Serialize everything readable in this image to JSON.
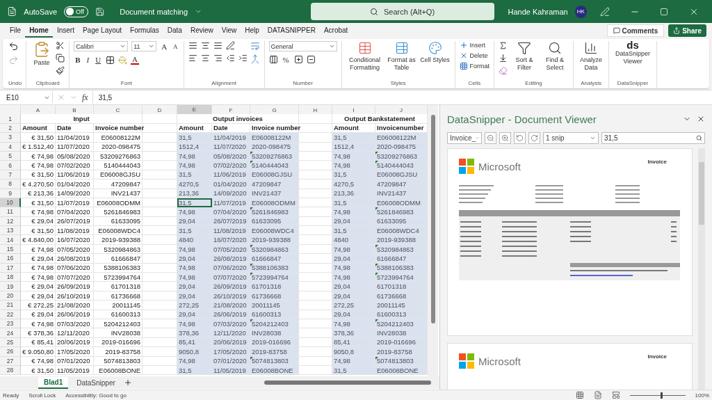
{
  "title_bar": {
    "autosave_label": "AutoSave",
    "autosave_toggle": {
      "label": "Off",
      "on": false
    },
    "document_title": "Document matching",
    "search": {
      "placeholder": "Search (Alt+Q)"
    },
    "user_name": "Hande Kahraman",
    "avatar_initials": "HK"
  },
  "menu_tabs": [
    {
      "label": "File",
      "selected": false
    },
    {
      "label": "Home",
      "selected": true
    },
    {
      "label": "Insert",
      "selected": false
    },
    {
      "label": "Page Layout",
      "selected": false
    },
    {
      "label": "Formulas",
      "selected": false
    },
    {
      "label": "Data",
      "selected": false
    },
    {
      "label": "Review",
      "selected": false
    },
    {
      "label": "View",
      "selected": false
    },
    {
      "label": "Help",
      "selected": false
    },
    {
      "label": "DATASNIPPER",
      "selected": false
    },
    {
      "label": "Acrobat",
      "selected": false
    }
  ],
  "comments_button": "Comments",
  "share_button": "Share",
  "ribbon": [
    {
      "kind": "undo",
      "label": "Undo"
    },
    {
      "kind": "clipboard",
      "label": "Clipboard",
      "paste": "Paste"
    },
    {
      "kind": "font",
      "label": "Font",
      "font_name": "Calibri",
      "font_size": "11",
      "grow_font": "A",
      "shrink_font": "A",
      "bold": "B",
      "italic": "I",
      "underline": "U",
      "font_color": "A"
    },
    {
      "kind": "alignment",
      "label": "Alignment"
    },
    {
      "kind": "number",
      "label": "Number",
      "format": "General",
      "percent": "%"
    },
    {
      "kind": "styles",
      "label": "Styles",
      "buttons": [
        "Conditional Formatting",
        "Format as Table",
        "Cell Styles"
      ]
    },
    {
      "kind": "cells",
      "label": "Cells",
      "buttons": [
        "Insert",
        "Delete",
        "Format"
      ]
    },
    {
      "kind": "editing",
      "label": "Editing",
      "buttons": [
        "Sort & Filter",
        "Find & Select"
      ]
    },
    {
      "kind": "analysis",
      "label": "Analysis",
      "buttons": [
        "Analyze Data"
      ]
    },
    {
      "kind": "datasnipper",
      "label": "DataSnipper",
      "logo": "ds",
      "buttons": [
        "DataSnipper Viewer"
      ]
    }
  ],
  "formula_bar": {
    "name_box": "E10",
    "fx": "fx",
    "value": "31,5"
  },
  "sheet": {
    "columns": [
      {
        "label": "A",
        "selected": false
      },
      {
        "label": "B",
        "selected": false
      },
      {
        "label": "C",
        "selected": false
      },
      {
        "label": "D",
        "selected": false
      },
      {
        "label": "E",
        "selected": true
      },
      {
        "label": "F",
        "selected": false
      },
      {
        "label": "G",
        "selected": false
      },
      {
        "label": "H",
        "selected": false
      },
      {
        "label": "I",
        "selected": false
      },
      {
        "label": "J",
        "selected": false
      }
    ],
    "title_row": {
      "row": "1",
      "input": "Input",
      "output_invoices": "Output invoices",
      "output_bank": "Output Bankstatement"
    },
    "heading_row": {
      "row": "2",
      "input": [
        "Amount",
        "Date",
        "Invoice number"
      ],
      "output_invoices": [
        "Amount",
        "Date",
        "Invoice number"
      ],
      "output_bank": [
        "Amount",
        "Invoicenumber"
      ]
    },
    "rows": [
      {
        "row": "3",
        "input": [
          "€ 31,50",
          "11/04/2019",
          "E06008122M"
        ],
        "output_invoices": [
          "31,5",
          "11/04/2019",
          "E06008122M"
        ],
        "output_bank": [
          "31,5",
          "E06008122M"
        ],
        "flagged": false,
        "selected": false
      },
      {
        "row": "4",
        "input": [
          "€ 1.512,40",
          "11/07/2020",
          "2020-098475"
        ],
        "output_invoices": [
          "1512,4",
          "11/07/2020",
          "2020-098475"
        ],
        "output_bank": [
          "1512,4",
          "2020-098475"
        ],
        "flagged": false,
        "selected": false
      },
      {
        "row": "5",
        "input": [
          "€ 74,98",
          "05/08/2020",
          "53209276863"
        ],
        "output_invoices": [
          "74,98",
          "05/08/2020",
          "53209276863"
        ],
        "output_bank": [
          "74,98",
          "53209276863"
        ],
        "flagged": true,
        "selected": false
      },
      {
        "row": "6",
        "input": [
          "€ 74,98",
          "07/02/2020",
          "5140444043"
        ],
        "output_invoices": [
          "74,98",
          "07/02/2020",
          "5140444043"
        ],
        "output_bank": [
          "74,98",
          "5140444043"
        ],
        "flagged": true,
        "selected": false
      },
      {
        "row": "7",
        "input": [
          "€ 31,50",
          "11/06/2019",
          "E06008GJSU"
        ],
        "output_invoices": [
          "31,5",
          "11/06/2019",
          "E06008GJSU"
        ],
        "output_bank": [
          "31,5",
          "E06008GJSU"
        ],
        "flagged": false,
        "selected": false
      },
      {
        "row": "8",
        "input": [
          "€ 4.270,50",
          "01/04/2020",
          "47209847"
        ],
        "output_invoices": [
          "4270,5",
          "01/04/2020",
          "47209847"
        ],
        "output_bank": [
          "4270,5",
          "47209847"
        ],
        "flagged": false,
        "selected": false
      },
      {
        "row": "9",
        "input": [
          "€ 213,36",
          "14/09/2020",
          "INV21437"
        ],
        "output_invoices": [
          "213,36",
          "14/09/2020",
          "INV21437"
        ],
        "output_bank": [
          "213,36",
          "INV21437"
        ],
        "flagged": false,
        "selected": false
      },
      {
        "row": "10",
        "input": [
          "€ 31,50",
          "11/07/2019",
          "E06008ODMM"
        ],
        "output_invoices": [
          "31,5",
          "11/07/2019",
          "E06008ODMM"
        ],
        "output_bank": [
          "31,5",
          "E06008ODMM"
        ],
        "flagged": false,
        "selected": true
      },
      {
        "row": "11",
        "input": [
          "€ 74,98",
          "07/04/2020",
          "5261846983"
        ],
        "output_invoices": [
          "74,98",
          "07/04/2020",
          "5261846983"
        ],
        "output_bank": [
          "74,98",
          "5261846983"
        ],
        "flagged": true,
        "selected": false
      },
      {
        "row": "12",
        "input": [
          "€ 29,04",
          "26/07/2019",
          "61633095"
        ],
        "output_invoices": [
          "29,04",
          "26/07/2019",
          "61633095"
        ],
        "output_bank": [
          "29,04",
          "61633095"
        ],
        "flagged": false,
        "selected": false
      },
      {
        "row": "13",
        "input": [
          "€ 31,50",
          "11/08/2019",
          "E06008WDC4"
        ],
        "output_invoices": [
          "31,5",
          "11/08/2019",
          "E06008WDC4"
        ],
        "output_bank": [
          "31,5",
          "E06008WDC4"
        ],
        "flagged": false,
        "selected": false
      },
      {
        "row": "14",
        "input": [
          "€ 4.840,00",
          "16/07/2020",
          "2019-939388"
        ],
        "output_invoices": [
          "4840",
          "16/07/2020",
          "2019-939388"
        ],
        "output_bank": [
          "4840",
          "2019-939388"
        ],
        "flagged": false,
        "selected": false
      },
      {
        "row": "15",
        "input": [
          "€ 74,98",
          "07/05/2020",
          "5320984863"
        ],
        "output_invoices": [
          "74,98",
          "07/05/2020",
          "5320984863"
        ],
        "output_bank": [
          "74,98",
          "5320984863"
        ],
        "flagged": true,
        "selected": false
      },
      {
        "row": "16",
        "input": [
          "€ 29,04",
          "26/08/2019",
          "61666847"
        ],
        "output_invoices": [
          "29,04",
          "26/08/2019",
          "61666847"
        ],
        "output_bank": [
          "29,04",
          "61666847"
        ],
        "flagged": false,
        "selected": false
      },
      {
        "row": "17",
        "input": [
          "€ 74,98",
          "07/06/2020",
          "5388106383"
        ],
        "output_invoices": [
          "74,98",
          "07/06/2020",
          "5388106383"
        ],
        "output_bank": [
          "74,98",
          "5388106383"
        ],
        "flagged": true,
        "selected": false
      },
      {
        "row": "18",
        "input": [
          "€ 74,98",
          "07/07/2020",
          "5723994764"
        ],
        "output_invoices": [
          "74,98",
          "07/07/2020",
          "5723994764"
        ],
        "output_bank": [
          "74,98",
          "5723994764"
        ],
        "flagged": true,
        "selected": false
      },
      {
        "row": "19",
        "input": [
          "€ 29,04",
          "26/09/2019",
          "61701318"
        ],
        "output_invoices": [
          "29,04",
          "26/09/2019",
          "61701318"
        ],
        "output_bank": [
          "29,04",
          "61701318"
        ],
        "flagged": false,
        "selected": false
      },
      {
        "row": "20",
        "input": [
          "€ 29,04",
          "26/10/2019",
          "61736668"
        ],
        "output_invoices": [
          "29,04",
          "26/10/2019",
          "61736668"
        ],
        "output_bank": [
          "29,04",
          "61736668"
        ],
        "flagged": false,
        "selected": false
      },
      {
        "row": "21",
        "input": [
          "€ 272,25",
          "21/08/2020",
          "20011145"
        ],
        "output_invoices": [
          "272,25",
          "21/08/2020",
          "20011145"
        ],
        "output_bank": [
          "272,25",
          "20011145"
        ],
        "flagged": false,
        "selected": false
      },
      {
        "row": "22",
        "input": [
          "€ 29,04",
          "26/06/2019",
          "61600313"
        ],
        "output_invoices": [
          "29,04",
          "26/06/2019",
          "61600313"
        ],
        "output_bank": [
          "29,04",
          "61600313"
        ],
        "flagged": false,
        "selected": false
      },
      {
        "row": "23",
        "input": [
          "€ 74,98",
          "07/03/2020",
          "5204212403"
        ],
        "output_invoices": [
          "74,98",
          "07/03/2020",
          "5204212403"
        ],
        "output_bank": [
          "74,98",
          "5204212403"
        ],
        "flagged": true,
        "selected": false
      },
      {
        "row": "24",
        "input": [
          "€ 378,36",
          "12/11/2020",
          "INV28038"
        ],
        "output_invoices": [
          "378,36",
          "12/11/2020",
          "INV28038"
        ],
        "output_bank": [
          "378,36",
          "INV28038"
        ],
        "flagged": false,
        "selected": false
      },
      {
        "row": "25",
        "input": [
          "€ 85,41",
          "20/06/2019",
          "2019-016696"
        ],
        "output_invoices": [
          "85,41",
          "20/06/2019",
          "2019-016696"
        ],
        "output_bank": [
          "85,41",
          "2019-016696"
        ],
        "flagged": false,
        "selected": false
      },
      {
        "row": "26",
        "input": [
          "€ 9.050,80",
          "17/05/2020",
          "2019-83758"
        ],
        "output_invoices": [
          "9050,8",
          "17/05/2020",
          "2019-83758"
        ],
        "output_bank": [
          "9050,8",
          "2019-83758"
        ],
        "flagged": false,
        "selected": false
      },
      {
        "row": "27",
        "input": [
          "€ 74,98",
          "07/01/2020",
          "5074813803"
        ],
        "output_invoices": [
          "74,98",
          "07/01/2020",
          "5074813803"
        ],
        "output_bank": [
          "74,98",
          "5074813803"
        ],
        "flagged": true,
        "selected": false
      },
      {
        "row": "28",
        "input": [
          "€ 31,50",
          "11/05/2019",
          "E06008BONE"
        ],
        "output_invoices": [
          "31,5",
          "11/05/2019",
          "E06008BONE"
        ],
        "output_bank": [
          "31,5",
          "E06008BONE"
        ],
        "flagged": false,
        "selected": false
      }
    ]
  },
  "sheet_tabs": [
    {
      "label": "Blad1",
      "selected": true
    },
    {
      "label": "DataSnipper",
      "selected": false
    }
  ],
  "viewer": {
    "title": "DataSnipper - Document Viewer",
    "file_select": "Invoice_",
    "snip_select": "1 snip",
    "search_value": "31,5",
    "pages": [
      {
        "logo_text": "Microsoft",
        "heading": "Invoice"
      },
      {
        "logo_text": "Microsoft",
        "heading": "Invoice"
      }
    ]
  },
  "status_bar": {
    "items": [
      "Ready",
      "Scroll Lock",
      "Accessibility: Good to go"
    ],
    "zoom": {
      "level": 0.55,
      "reading": "100%"
    }
  }
}
